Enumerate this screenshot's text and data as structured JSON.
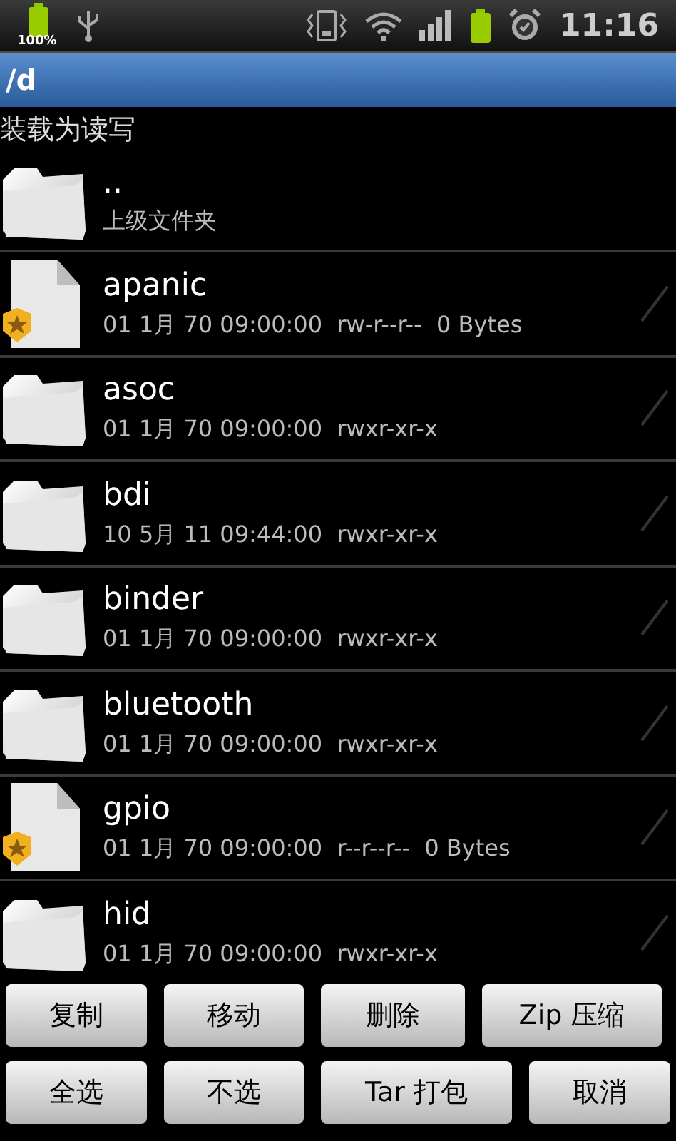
{
  "status_bar": {
    "battery_label": "100%",
    "time": "11:16"
  },
  "title": "/d",
  "mount_label": "装载为读写",
  "parent": {
    "name": "..",
    "label": "上级文件夹"
  },
  "files": [
    {
      "kind": "file",
      "name": "apanic",
      "details": "01 1月 70 09:00:00  rw-r--r--  0 Bytes",
      "checked": false
    },
    {
      "kind": "folder",
      "name": "asoc",
      "details": "01 1月 70 09:00:00  rwxr-xr-x",
      "checked": false
    },
    {
      "kind": "folder",
      "name": "bdi",
      "details": "10 5月 11 09:44:00  rwxr-xr-x",
      "checked": false
    },
    {
      "kind": "folder",
      "name": "binder",
      "details": "01 1月 70 09:00:00  rwxr-xr-x",
      "checked": false
    },
    {
      "kind": "folder",
      "name": "bluetooth",
      "details": "01 1月 70 09:00:00  rwxr-xr-x",
      "checked": false
    },
    {
      "kind": "file",
      "name": "gpio",
      "details": "01 1月 70 09:00:00  r--r--r--  0 Bytes",
      "checked": false
    },
    {
      "kind": "folder",
      "name": "hid",
      "details": "01 1月 70 09:00:00  rwxr-xr-x",
      "checked": false
    }
  ],
  "buttons": [
    [
      "复制",
      "移动",
      "删除",
      "Zip 压缩"
    ],
    [
      "全选",
      "不选",
      "Tar 打包",
      "取消"
    ]
  ]
}
